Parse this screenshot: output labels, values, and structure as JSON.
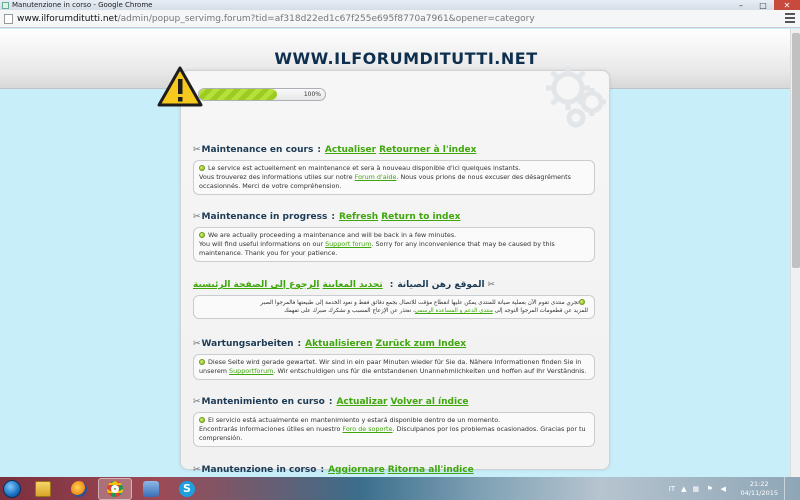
{
  "window": {
    "title": "Manutenzione in corso - Google Chrome",
    "url_host": "www.ilforumditutti.net",
    "url_path": "/admin/popup_servimg.forum?tid=af318d22ed1c67f255e695f8770a7961&opener=category"
  },
  "site": {
    "title": "WWW.ILFORUMDITUTTI.NET"
  },
  "progress": {
    "percent": 100,
    "label": "100%"
  },
  "sections": [
    {
      "title": "Maintenance en cours",
      "sep": ":",
      "link1": "Actualiser",
      "link2": "Retourner à l'index",
      "line1": "Le service est actuellement en maintenance et sera à nouveau disponible d'ici quelques instants.",
      "line2_pre": "Vous trouverez des informations utiles sur notre ",
      "line2_link": "Forum d'aide",
      "line2_post": ". Nous vous prions de nous excuser des désagréments occasionnés. Merci de votre compréhension."
    },
    {
      "title": "Maintenance in progress",
      "sep": ":",
      "link1": "Refresh",
      "link2": "Return to index",
      "line1": "We are actually proceeding a maintenance and will be back in a few minutes.",
      "line2_pre": "You will find useful informations on our ",
      "line2_link": "Support forum",
      "line2_post": ". Sorry for any inconvenience that may be caused by this maintenance. Thank you for your patience."
    },
    {
      "title": "الموقع رهن الصيانة",
      "sep": ":",
      "link1": "تحديد المعاينة",
      "link2": "الرجوع إلى الصفحة الرئيسية",
      "line1": "تجري منتدى تقوم الآن بعملية صيانة للمنتدى يمكن عليها انقطاع مؤقت للاتصال بجمع دقائق فقط و نعود الخدمة إلى طبيعتها فالمرجوا الصبر",
      "line2_pre": "للمزيد عن قطعومات المرجوا التوجه إلى ",
      "line2_link": "منتدى الدعم و المساعدة الرسمي",
      "line2_post": "، نعتذر عن الإزعاج المسبب و نشكرك صبرك على تفهمك"
    },
    {
      "title": "Wartungsarbeiten",
      "sep": ":",
      "link1": "Aktualisieren",
      "link2": "Zurück zum Index",
      "line1": "Diese Seite wird gerade gewartet. Wir sind in ein paar Minuten wieder für Sie da. Nähere Informationen finden Sie in",
      "line2_pre": "unserem ",
      "line2_link": "Supportforum",
      "line2_post": ". Wir entschuldigen uns für die entstandenen Unannehmlichkeiten und hoffen auf Ihr Verständnis."
    },
    {
      "title": "Mantenimiento en curso",
      "sep": ":",
      "link1": "Actualizar",
      "link2": "Volver al índice",
      "line1": "El servicio está actualmente en mantenimiento y estará disponible dentro de un momento.",
      "line2_pre": "Encontrarás informaciones útiles en nuestro ",
      "line2_link": "Foro de soporte",
      "line2_post": ". Disculpanos por los problemas ocasionados. Gracias por tu comprensión."
    },
    {
      "title": "Manutenzione in corso",
      "sep": ":",
      "link1": "Aggiornare",
      "link2": "Ritorna all'indice",
      "line1": "",
      "line2_pre": "",
      "line2_link": "",
      "line2_post": ""
    }
  ],
  "taskbar": {
    "language": "IT",
    "time": "21:22",
    "date": "04/11/2015"
  },
  "colors": {
    "link_green": "#3fa70b",
    "heading_navy": "#1d3b55",
    "page_background": "#c8eefa",
    "close_button": "#c74a3d"
  }
}
